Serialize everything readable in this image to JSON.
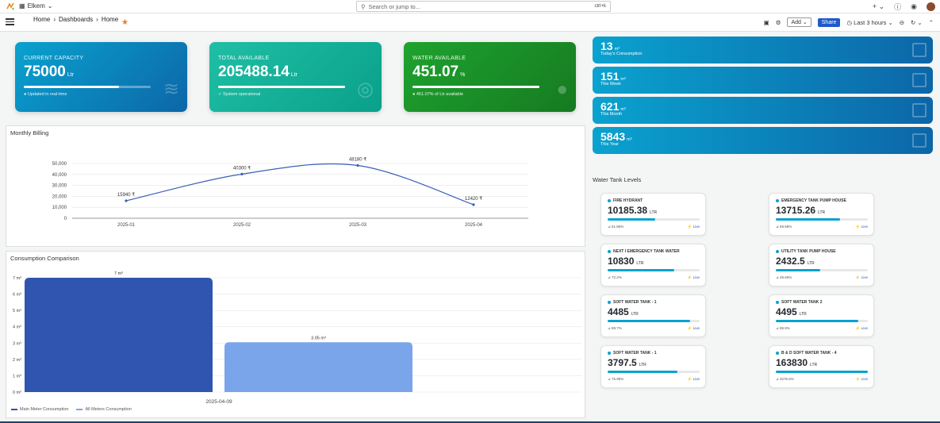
{
  "topbar": {
    "org": "Elkem",
    "search_placeholder": "Search or jump to...",
    "search_shortcut": "ctrl+k",
    "plus": "+"
  },
  "navbar": {
    "breadcrumb": [
      "Home",
      "Dashboards",
      "Home"
    ],
    "add_label": "Add",
    "share_label": "Share",
    "time_range": "Last 3 hours"
  },
  "cards": [
    {
      "label": "CURRENT CAPACITY",
      "value": "75000",
      "unit": "Ltr",
      "footer": "Updated in real-time",
      "progress": 0.75,
      "color_from": "#0aa2cf",
      "color_to": "#0c66a8"
    },
    {
      "label": "TOTAL AVAILABLE",
      "value": "205488.14",
      "unit": "Ltr",
      "footer": "System operational",
      "progress": 1.0,
      "color_from": "#1fbfa5",
      "color_to": "#0aa08a"
    },
    {
      "label": "WATER AVAILABLE",
      "value": "451.07",
      "unit": "%",
      "footer": "451.07% of Ltr available",
      "progress": 1.0,
      "color_from": "#1ea32e",
      "color_to": "#167a21"
    }
  ],
  "stats": [
    {
      "value": "13",
      "unit": "m³",
      "label": "Today's Consumption"
    },
    {
      "value": "151",
      "unit": "m³",
      "label": "This Week"
    },
    {
      "value": "621",
      "unit": "m³",
      "label": "This Month"
    },
    {
      "value": "5843",
      "unit": "m³",
      "label": "This Year"
    }
  ],
  "billing": {
    "title": "Monthly Billing",
    "chart_data": {
      "type": "line",
      "categories": [
        "2025-01",
        "2025-02",
        "2025-03",
        "2025-04"
      ],
      "values": [
        15940,
        40300,
        48180,
        12420
      ],
      "labels": [
        "15940 ₹",
        "40300 ₹",
        "48180 ₹",
        "12420 ₹"
      ],
      "yticks": [
        "0",
        "10,000",
        "20,000",
        "30,000",
        "40,000",
        "50,000"
      ],
      "ylim": [
        0,
        50000
      ],
      "color": "#3a5fb5"
    }
  },
  "consumption": {
    "title": "Consumption Comparison",
    "chart_data": {
      "type": "bar",
      "categories": [
        "2025-04-09"
      ],
      "series": [
        {
          "name": "Main Meter Consumption",
          "values": [
            7
          ],
          "label": "7 m³",
          "color": "#2f55b0"
        },
        {
          "name": "All Meters Consumption",
          "values": [
            3.05
          ],
          "label": "3.05 m³",
          "color": "#7aa5ea"
        }
      ],
      "yticks": [
        "0 m³",
        "1 m³",
        "2 m³",
        "3 m³",
        "4 m³",
        "5 m³",
        "6 m³",
        "7 m³"
      ],
      "ylim": [
        0,
        7
      ]
    }
  },
  "tanks": {
    "title": "Water Tank Levels",
    "items": [
      {
        "name": "FIRE HYDRANT",
        "value": "10185.38",
        "unit": "LTR",
        "pct": "51.86%",
        "fill": 0.5186,
        "status": "Live"
      },
      {
        "name": "EMERGENCY TANK PUMP HOUSE",
        "value": "13715.26",
        "unit": "LTR",
        "pct": "69.58%",
        "fill": 0.6958,
        "status": "Live"
      },
      {
        "name": "NEXT I EMERGENCY TANK WATER",
        "value": "10830",
        "unit": "LTR",
        "pct": "72.2%",
        "fill": 0.722,
        "status": "Live"
      },
      {
        "name": "UTILITY TANK PUMP HOUSE",
        "value": "2432.5",
        "unit": "LTR",
        "pct": "48.65%",
        "fill": 0.4865,
        "status": "Live"
      },
      {
        "name": "SOFT WATER TANK - 1",
        "value": "4485",
        "unit": "LTR",
        "pct": "89.7%",
        "fill": 0.897,
        "status": "Live"
      },
      {
        "name": "SOFT WATER TANK 2",
        "value": "4495",
        "unit": "LTR",
        "pct": "89.9%",
        "fill": 0.899,
        "status": "Live"
      },
      {
        "name": "SOFT WATER TANK - 1",
        "value": "3797.5",
        "unit": "LTR",
        "pct": "75.95%",
        "fill": 0.7595,
        "status": "Live"
      },
      {
        "name": "B & D SOFT WATER TANK - 4",
        "value": "163830",
        "unit": "LTR",
        "pct": "3276.6%",
        "fill": 1.0,
        "status": "Live"
      }
    ]
  }
}
